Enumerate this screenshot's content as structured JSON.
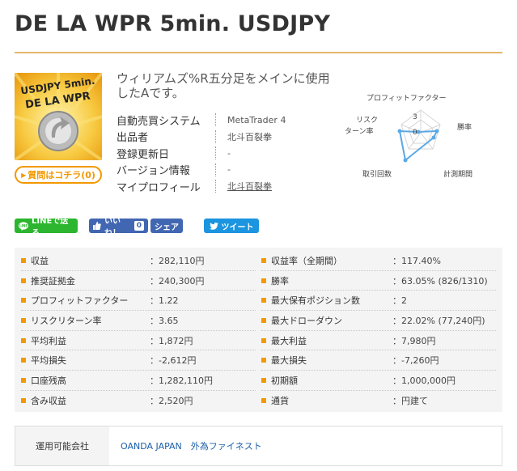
{
  "page": {
    "title": "DE LA WPR 5min. USDJPY"
  },
  "product": {
    "thumb_text_1": "USDJPY 5min.",
    "thumb_text_2": "DE LA WPR",
    "question_button": "質問はコチラ(0)",
    "description": "ウィリアムズ%R五分足をメインに使用したAです。",
    "info": [
      {
        "label": "自動売買システム",
        "value": "MetaTrader 4"
      },
      {
        "label": "出品者",
        "value": "北斗百裂拳"
      },
      {
        "label": "登録更新日",
        "value": "-"
      },
      {
        "label": "バージョン情報",
        "value": "-"
      },
      {
        "label": "マイプロフィール",
        "value": "北斗百裂拳"
      }
    ]
  },
  "radar": {
    "labels": [
      "プロフィットファクター",
      "勝率",
      "計測期間",
      "取引回数",
      "リスク",
      "ターン率"
    ],
    "scale_max": "3",
    "scale_zero": "0",
    "accent": "#5aa9e6"
  },
  "social": {
    "line": "LINEで送る",
    "like": "いいね！",
    "like_count": "0",
    "share": "シェア",
    "tweet": "ツイート"
  },
  "stats": {
    "left": [
      {
        "label": "収益",
        "value": "：282,110円"
      },
      {
        "label": "推奨証拠金",
        "value": "：240,300円"
      },
      {
        "label": "プロフィットファクター",
        "value": "：1.22"
      },
      {
        "label": "リスクリターン率",
        "value": "：3.65"
      },
      {
        "label": "平均利益",
        "value": "：1,872円"
      },
      {
        "label": "平均損失",
        "value": "：-2,612円"
      },
      {
        "label": "口座残高",
        "value": "：1,282,110円"
      },
      {
        "label": "含み収益",
        "value": "：2,520円"
      }
    ],
    "right": [
      {
        "label": "収益率（全期間）",
        "value": "：117.40%"
      },
      {
        "label": "勝率",
        "value": "：63.05% (826/1310)"
      },
      {
        "label": "最大保有ポジション数",
        "value": "：2"
      },
      {
        "label": "最大ドローダウン",
        "value": "：22.02% (77,240円)"
      },
      {
        "label": "最大利益",
        "value": "：7,980円"
      },
      {
        "label": "最大損失",
        "value": "：-7,260円"
      },
      {
        "label": "初期額",
        "value": "：1,000,000円"
      },
      {
        "label": "通貨",
        "value": "：円建て"
      }
    ]
  },
  "broker": {
    "label": "運用可能会社",
    "value": "OANDA JAPAN　外為ファイネスト"
  }
}
